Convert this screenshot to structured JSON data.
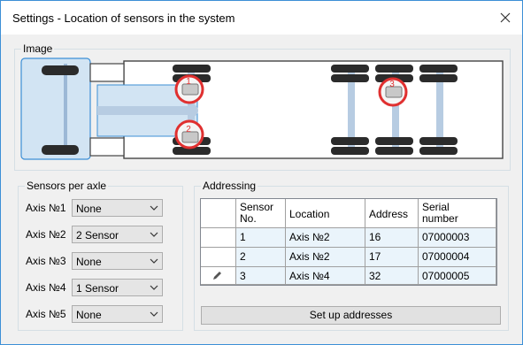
{
  "window": {
    "title": "Settings - Location of sensors in the system"
  },
  "image_group": {
    "legend": "Image",
    "markers": [
      "1",
      "2",
      "3"
    ]
  },
  "sensors_group": {
    "legend": "Sensors per axle",
    "axes": [
      {
        "label": "Axis №1",
        "value": "None"
      },
      {
        "label": "Axis №2",
        "value": "2 Sensor"
      },
      {
        "label": "Axis №3",
        "value": "None"
      },
      {
        "label": "Axis №4",
        "value": "1 Sensor"
      },
      {
        "label": "Axis №5",
        "value": "None"
      }
    ]
  },
  "addressing_group": {
    "legend": "Addressing",
    "columns": {
      "sensor_no": "Sensor\nNo.",
      "location": "Location",
      "address": "Address",
      "serial": "Serial\nnumber"
    },
    "rows": [
      {
        "sensor_no": "1",
        "location": "Axis №2",
        "address": "16",
        "serial": "07000003"
      },
      {
        "sensor_no": "2",
        "location": "Axis №2",
        "address": "17",
        "serial": "07000004"
      },
      {
        "sensor_no": "3",
        "location": "Axis №4",
        "address": "32",
        "serial": "07000005"
      }
    ],
    "button": "Set up addresses"
  },
  "colors": {
    "accent": "#3c8fd6",
    "marker_red": "#e03030",
    "selection": "#eaf4fb"
  }
}
